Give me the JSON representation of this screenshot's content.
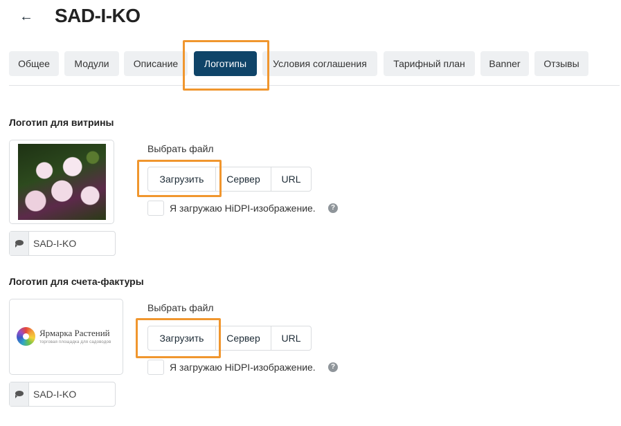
{
  "header": {
    "back_icon": "arrow-left-icon",
    "back_glyph": "←",
    "title": "SAD-I-KO"
  },
  "tabs": [
    {
      "label": "Общее"
    },
    {
      "label": "Модули"
    },
    {
      "label": "Описание"
    },
    {
      "label": "Логотипы",
      "active": true
    },
    {
      "label": "Условия соглашения"
    },
    {
      "label": "Тарифный план"
    },
    {
      "label": "Banner"
    },
    {
      "label": "Отзывы"
    }
  ],
  "sections": [
    {
      "title": "Логотип для витрины",
      "image": "flowers-photo",
      "caption": "SAD-I-KO",
      "choose_file_label": "Выбрать файл",
      "buttons": {
        "upload": "Загрузить",
        "server": "Сервер",
        "url": "URL"
      },
      "hidpi_label": "Я загружаю HiDPI-изображение.",
      "help_glyph": "?"
    },
    {
      "title": "Логотип для счета-фактуры",
      "image": "brand-logo",
      "brand_name": "Ярмарка Растений",
      "brand_tagline": "торговая площадка для садоводов",
      "caption": "SAD-I-KO",
      "choose_file_label": "Выбрать файл",
      "buttons": {
        "upload": "Загрузить",
        "server": "Сервер",
        "url": "URL"
      },
      "hidpi_label": "Я загружаю HiDPI-изображение.",
      "help_glyph": "?"
    }
  ],
  "colors": {
    "accent": "#0f4468",
    "highlight": "#f0962e",
    "tab_bg": "#eef0f2"
  }
}
